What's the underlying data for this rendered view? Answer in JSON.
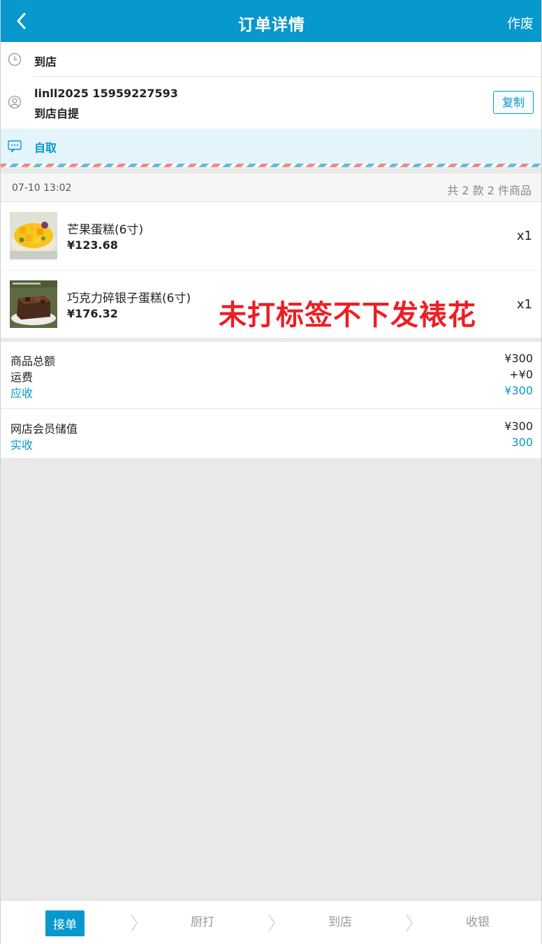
{
  "header": {
    "title": "订单详情",
    "action_label": "作废"
  },
  "info": {
    "arrive_label": "到店",
    "customer_line": "linll2025 15959227593",
    "pickup_label": "到店自提",
    "copy_label": "复制",
    "note_label": "自取"
  },
  "order": {
    "time": "07-10 13:02",
    "summary": "共 2 款 2 件商品",
    "items": [
      {
        "name": "芒果蛋糕(6寸)",
        "price": "¥123.68",
        "qty": "x1"
      },
      {
        "name": "巧克力碎银子蛋糕(6寸)",
        "price": "¥176.32",
        "qty": "x1"
      }
    ]
  },
  "overlay_note": "未打标签不下发裱花",
  "totals": {
    "goods_label": "商品总额",
    "goods_value": "¥300",
    "shipping_label": "运费",
    "shipping_value": "+¥0",
    "due_label": "应收",
    "due_value": "¥300"
  },
  "payments": {
    "method_label": "网店会员储值",
    "method_value": "¥300",
    "received_label": "实收",
    "received_value": "300"
  },
  "steps": [
    {
      "label": "接单",
      "active": true
    },
    {
      "label": "厨打",
      "active": false
    },
    {
      "label": "到店",
      "active": false
    },
    {
      "label": "收银",
      "active": false
    }
  ],
  "colors": {
    "brand": "#0798cd",
    "overlay": "#ee1d23"
  }
}
